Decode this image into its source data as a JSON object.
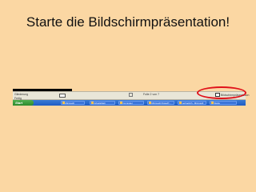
{
  "slide": {
    "title": "Starte die Bildschirmpräsentation!"
  },
  "statusbar": {
    "view_label": "Gliederung",
    "sub_label": "Fertig",
    "slide_counter": "Folie 2 von 7",
    "present_label": "Bildschirmpräsentation"
  },
  "taskbar": {
    "start_label": "Start",
    "buttons": [
      {
        "label": "Microsoft"
      },
      {
        "label": "Arbeitsblatt"
      },
      {
        "label": "Computer"
      },
      {
        "label": "Microsoft PowerP..."
      },
      {
        "label": "vertraglich - Microsoft"
      },
      {
        "label": "Starte"
      }
    ]
  },
  "colors": {
    "background": "#fbd7a3",
    "highlight_oval": "#e0121a",
    "taskbar": "#1f5cc4",
    "start_button": "#2d8a2d"
  }
}
